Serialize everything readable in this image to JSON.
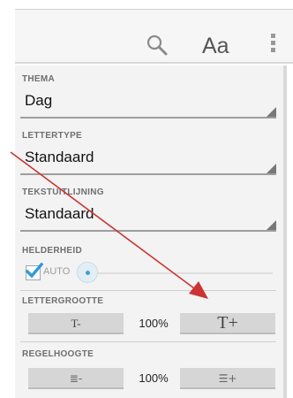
{
  "toolbar": {
    "font_size_label": "Aa",
    "icons": [
      "search-icon",
      "overflow-menu-icon"
    ]
  },
  "settings": {
    "theme": {
      "label": "THEMA",
      "value": "Dag"
    },
    "font": {
      "label": "LETTERTYPE",
      "value": "Standaard"
    },
    "alignment": {
      "label": "TEKSTUITLIJNING",
      "value": "Standaard"
    },
    "brightness": {
      "label": "HELDERHEID",
      "auto_label": "AUTO",
      "auto_checked": true,
      "level": 0
    },
    "font_size": {
      "label": "LETTERGROOTTE",
      "decrease_label": "T-",
      "increase_label": "T+",
      "value": "100%"
    },
    "line_height": {
      "label": "REGELHOOGTE",
      "decrease_label": "≣-",
      "increase_label": "☰+",
      "value": "100%"
    }
  },
  "colors": {
    "accent": "#3aa3d8",
    "annotation_arrow": "#cc3333",
    "panel_background": "#f3f3f3"
  }
}
